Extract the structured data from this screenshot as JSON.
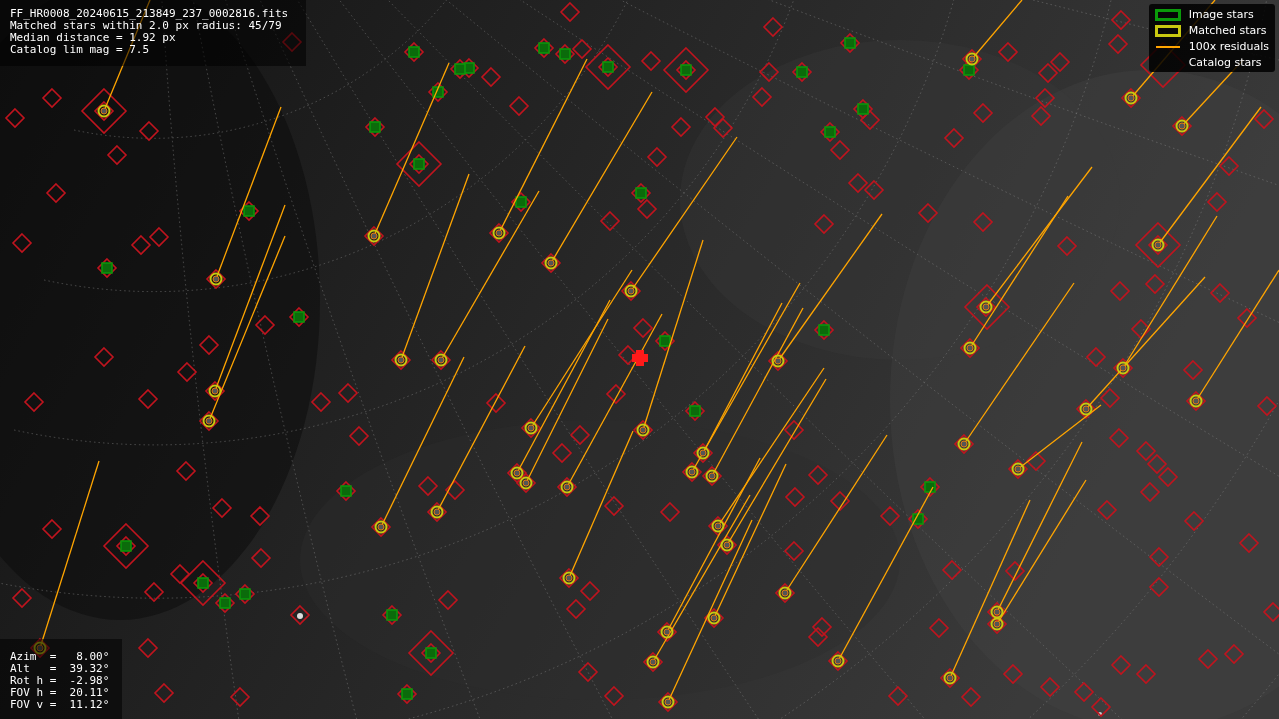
{
  "image_info": {
    "lines": [
      "FF_HR0008_20240615_213849_237_0002816.fits",
      "Matched stars within 2.0 px radius: 45/79",
      "Median distance = 1.92 px",
      "Catalog lim mag = 7.5"
    ]
  },
  "legend": {
    "items": [
      {
        "label": "Image stars"
      },
      {
        "label": "Matched stars",
        "kind": "matched"
      },
      {
        "label": "100x residuals",
        "kind": "residual"
      },
      {
        "label": "Catalog stars",
        "kind": "catalog"
      }
    ]
  },
  "pointing": {
    "lines": [
      "Azim  =   8.00°",
      "Alt   =  39.32°",
      "Rot h =  -2.98°",
      "FOV h =  20.11°",
      "FOV v =  11.12°"
    ]
  }
}
